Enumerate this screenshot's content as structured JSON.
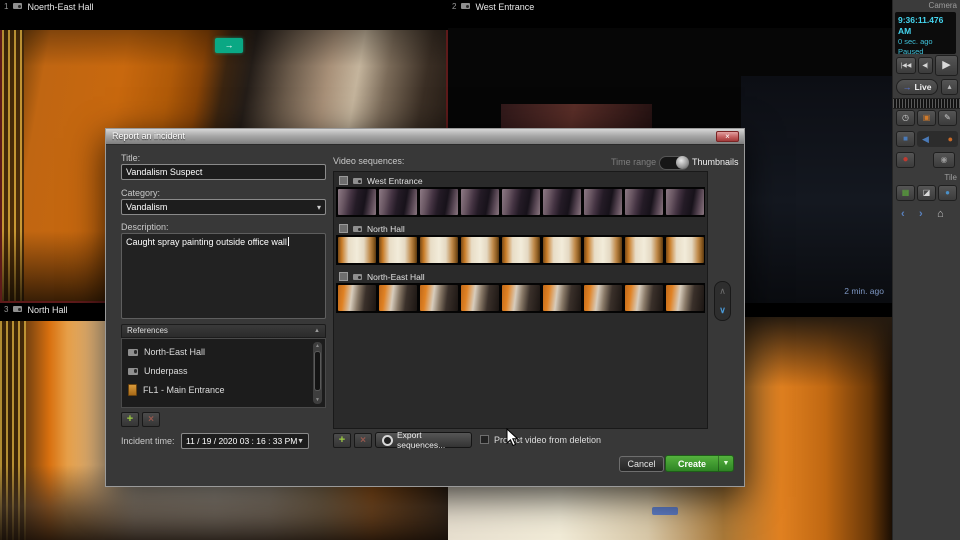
{
  "video_wall": {
    "tiles": [
      {
        "number": "1",
        "name": "Noerth-East Hall"
      },
      {
        "number": "2",
        "name": "West Entrance",
        "recording_age": "2 min. ago"
      },
      {
        "number": "3",
        "name": "North Hall"
      },
      {
        "number": "4",
        "name": ""
      }
    ]
  },
  "sidebar": {
    "panel_label": "Camera",
    "status": {
      "timestamp": "9:36:11.476 AM",
      "relative": "0 sec. ago",
      "state": "Paused"
    },
    "live_button": "Live",
    "tile_label": "Tile",
    "icons": {
      "skip_to_start": "|◀◀",
      "step_back": "◀|",
      "play": "▶",
      "live_arrow": "→",
      "expand_up": "▴",
      "clock": "◷",
      "smart_search": "▣",
      "pen": "✎",
      "blue_square": "■",
      "back_arrow": "◀",
      "orange_dot": "●",
      "record": "●",
      "audio": "◉",
      "grid": "▦",
      "snapshot": "◪",
      "ptz": "●",
      "prev": "‹",
      "next": "›",
      "home": "⌂"
    }
  },
  "dialog": {
    "title": "Report an incident",
    "close_glyph": "×",
    "form": {
      "title_label": "Title:",
      "title_value": "Vandalism Suspect",
      "category_label": "Category:",
      "category_value": "Vandalism",
      "description_label": "Description:",
      "description_value": "Caught spray painting outside office wall"
    },
    "references": {
      "header": "References",
      "items": [
        {
          "icon": "camera",
          "name": "North-East Hall"
        },
        {
          "icon": "camera",
          "name": "Underpass"
        },
        {
          "icon": "door",
          "name": "FL1 - Main Entrance"
        }
      ]
    },
    "incident_time": {
      "label": "Incident time:",
      "value": "11 / 19 / 2020   03 : 16 : 33 PM"
    },
    "sequences_panel": {
      "label": "Video sequences:",
      "time_range_label": "Time range",
      "thumbnails_label": "Thumbnails",
      "groups": [
        {
          "name": "West Entrance",
          "thumbnail_count": 9,
          "style": "west"
        },
        {
          "name": "North Hall",
          "thumbnail_count": 9,
          "style": "north"
        },
        {
          "name": "North-East Hall",
          "thumbnail_count": 9,
          "style": "northeast"
        }
      ],
      "export_button": "Export sequences...",
      "protect_checkbox_label": "Protect video from deletion"
    },
    "actions": {
      "cancel": "Cancel",
      "create": "Create",
      "create_dropdown": "▼"
    },
    "icons": {
      "add": "+",
      "remove": "×",
      "dropdown": "▾",
      "collapse": "▲",
      "scroll_up": "∧",
      "scroll_down": "∨",
      "exit_arrow": "→"
    }
  },
  "colors": {
    "accent_green": "#2e8424",
    "status_cyan": "#45d6f0",
    "age_badge_blue": "#7d97c3",
    "selected_tile_border": "#6e1f1f"
  }
}
